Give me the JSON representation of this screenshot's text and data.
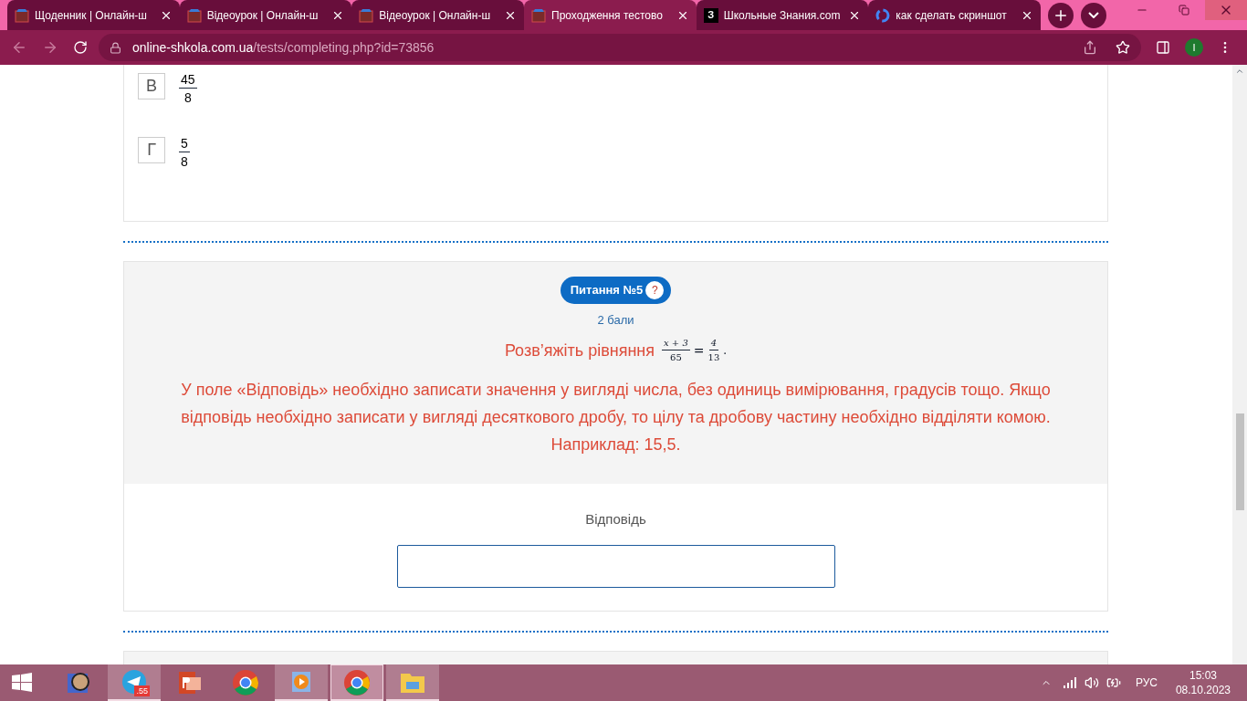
{
  "tabs": [
    {
      "title": "Щоденник | Онлайн-ш",
      "kind": "school",
      "selected": false
    },
    {
      "title": "Відеоурок | Онлайн-ш",
      "kind": "school",
      "selected": false
    },
    {
      "title": "Відеоурок | Онлайн-ш",
      "kind": "school",
      "selected": false
    },
    {
      "title": "Проходження тестово",
      "kind": "school",
      "selected": true
    },
    {
      "title": "Школьные Знания.com",
      "kind": "letter",
      "letter": "З",
      "selected": false
    },
    {
      "title": "как сделать скриншот",
      "kind": "google",
      "selected": false
    }
  ],
  "address": {
    "domain": "online-shkola.com.ua",
    "path": "/tests/completing.php?id=73856"
  },
  "profile": {
    "initial": "I"
  },
  "options": [
    {
      "letter": "В",
      "numerator": "45",
      "denominator": "8"
    },
    {
      "letter": "Г",
      "numerator": "5",
      "denominator": "8"
    }
  ],
  "question": {
    "badge": "Питання №5",
    "help": "?",
    "points": "2 бали",
    "prompt": "Розв’яжіть рівняння",
    "equation": {
      "left_numerator": "x + 3",
      "left_denominator": "65",
      "sign": "=",
      "right_numerator": "4",
      "right_denominator": "13",
      "end": "."
    },
    "instructions": "У поле «Відповідь» необхідно записати значення у вигляді числа, без одиниць вимірювання, градусів тощо. Якщо відповідь необхідно записати у вигляді десяткового дробу, то цілу та дробову частину необхідно відділяти комою. Наприклад: 15,5.",
    "answer_label": "Відповідь"
  },
  "taskbar": [
    {
      "kind": "photo",
      "active": false,
      "selected": false
    },
    {
      "kind": "telegram",
      "active": true,
      "selected": false,
      "badge": ".55"
    },
    {
      "kind": "powerpoint",
      "active": false,
      "selected": false
    },
    {
      "kind": "chrome",
      "active": false,
      "selected": false
    },
    {
      "kind": "player",
      "active": true,
      "selected": false
    },
    {
      "kind": "chrome",
      "active": true,
      "selected": true
    },
    {
      "kind": "explorer",
      "active": true,
      "selected": false
    }
  ],
  "tray": {
    "language": "РУС",
    "time": "15:03",
    "date": "08.10.2023"
  }
}
